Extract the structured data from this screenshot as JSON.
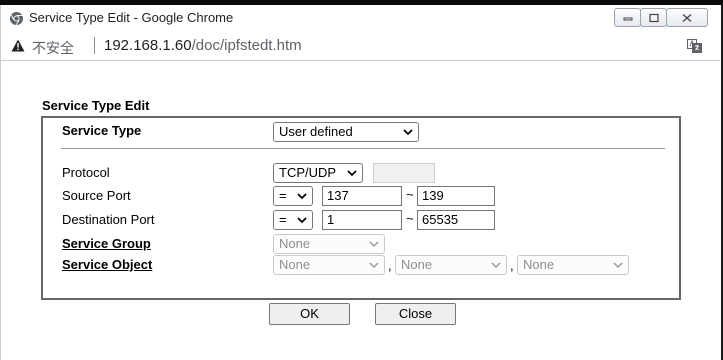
{
  "window": {
    "title": "Service Type Edit - Google Chrome"
  },
  "address": {
    "security_label": "不安全",
    "host": "192.168.1.60",
    "path": "/doc/ipfstedt.htm"
  },
  "form": {
    "heading": "Service Type Edit",
    "service_type": {
      "label": "Service Type",
      "value": "User defined"
    },
    "protocol": {
      "label": "Protocol",
      "value": "TCP/UDP",
      "number": ""
    },
    "source_port": {
      "label": "Source Port",
      "operator": "=",
      "start": "137",
      "end": "139",
      "range_sep": "~"
    },
    "destination_port": {
      "label": "Destination Port",
      "operator": "=",
      "start": "1",
      "end": "65535",
      "range_sep": "~"
    },
    "service_group": {
      "label": "Service Group",
      "value": "None"
    },
    "service_object": {
      "label": "Service Object",
      "values": [
        "None",
        "None",
        "None"
      ],
      "separator": ","
    }
  },
  "buttons": {
    "ok": "OK",
    "close": "Close"
  },
  "colors": {
    "warning": "#202124",
    "chrome_blue": "#4a6fa5"
  }
}
